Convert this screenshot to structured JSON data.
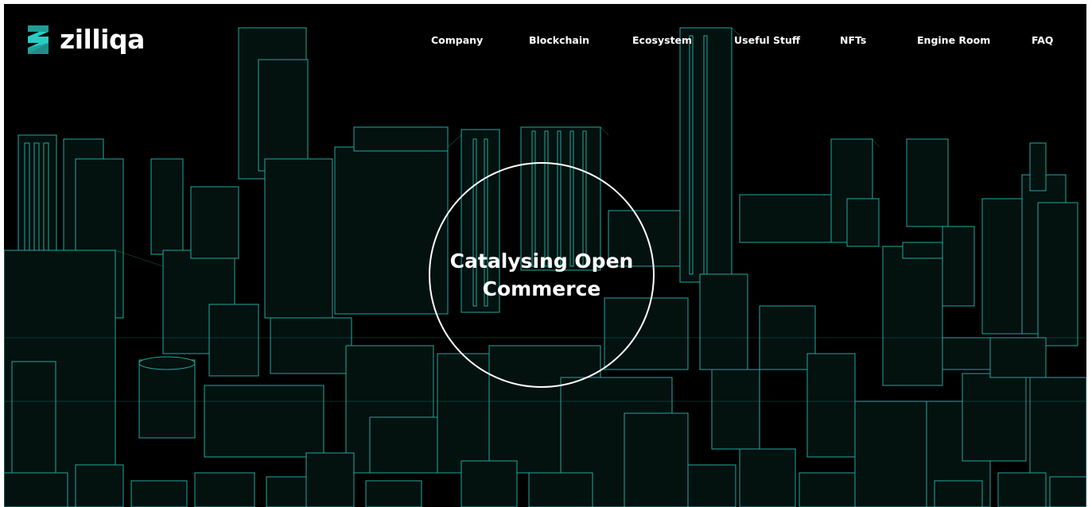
{
  "brand": {
    "name": "zilliqa",
    "accent_color": "#29ccc4"
  },
  "nav": {
    "items": [
      {
        "label": "Company"
      },
      {
        "label": "Blockchain"
      },
      {
        "label": "Ecosystem"
      },
      {
        "label": "Useful Stuff"
      },
      {
        "label": "NFTs"
      },
      {
        "label": "Engine Room"
      },
      {
        "label": "FAQ"
      }
    ]
  },
  "hero": {
    "title_line1": "Catalysing Open",
    "title_line2": "Commerce"
  },
  "background": {
    "color": "#000000",
    "wireframe_color": "#29c3b8"
  }
}
